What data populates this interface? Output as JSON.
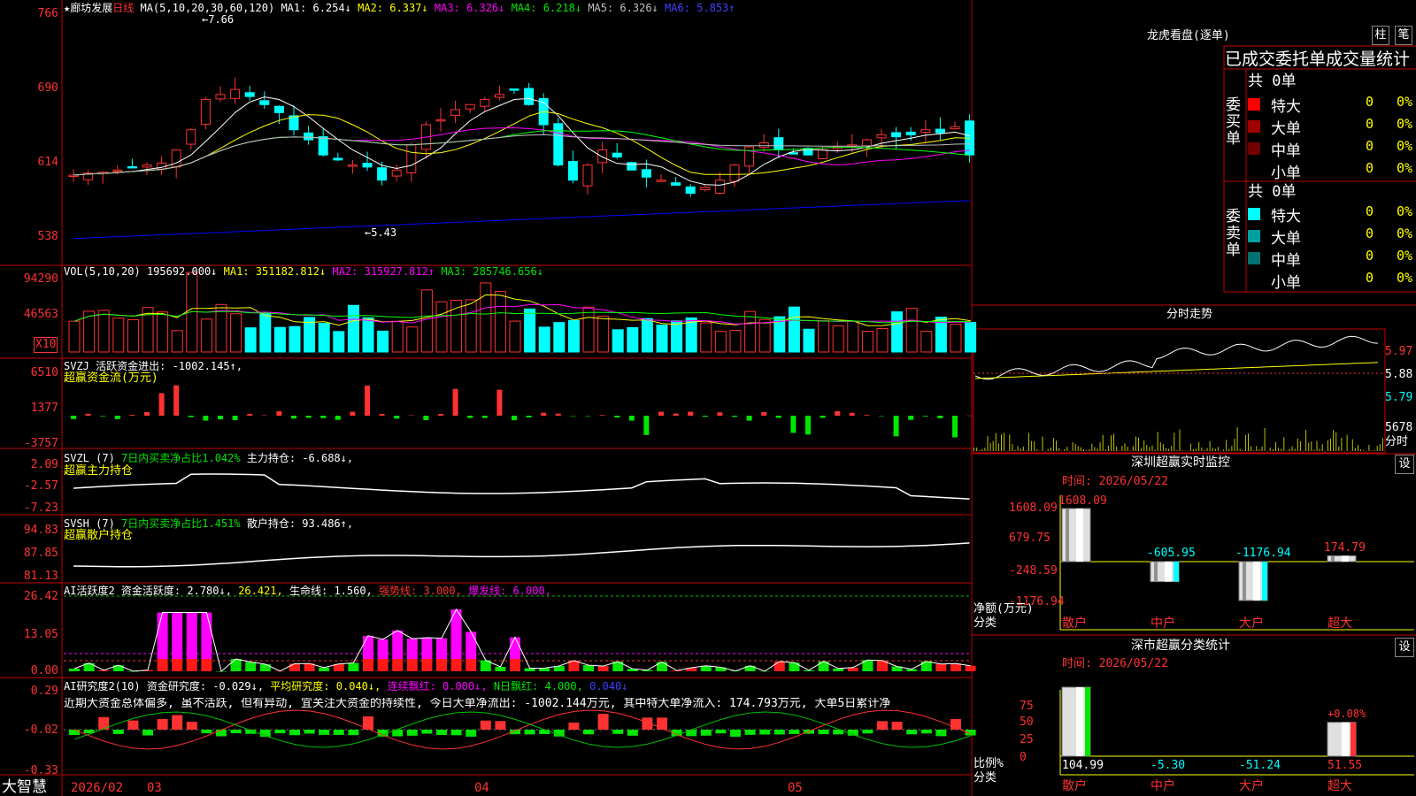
{
  "stock": {
    "name": "★廊坊发展",
    "period": "日线"
  },
  "ma_header": {
    "label": "MA(5,10,20,30,60,120)",
    "ma1": "MA1: 6.254↓",
    "ma2": "MA2: 6.337↓",
    "ma3": "MA3: 6.326↓",
    "ma4": "MA4: 6.218↓",
    "ma5": "MA5: 6.326↓",
    "ma6": "MA6: 5.853↑"
  },
  "price_axis": [
    "766",
    "690",
    "614",
    "538"
  ],
  "price_marks": {
    "high": "7.66",
    "low": "5.43"
  },
  "vol_header": {
    "label": "VOL(5,10,20)",
    "value": "195692.000↓",
    "ma1": "MA1: 351182.812↓",
    "ma2": "MA2: 315927.812↑",
    "ma3": "MA3: 285746.656↓"
  },
  "vol_axis": [
    "94290",
    "46563"
  ],
  "vol_unit": "X10",
  "svzj": {
    "line1": "SVZJ  活跃资金进出: -1002.145↑,",
    "line2": "超赢资金流(万元)",
    "axis": [
      "6510",
      "1377",
      "-3757"
    ]
  },
  "svzl": {
    "label": "SVZL (7)",
    "pct": "7日内买卖净占比1.042%",
    "hold": "主力持仓: -6.688↓,",
    "line2": "超赢主力持仓",
    "axis": [
      "2.09",
      "-2.57",
      "-7.23"
    ]
  },
  "svsh": {
    "label": "SVSH (7)",
    "pct": "7日内买卖净占比1.451%",
    "hold": "散户持仓: 93.486↑,",
    "line2": "超赢散户持仓",
    "axis": [
      "94.83",
      "87.85",
      "81.13"
    ]
  },
  "ai_act": {
    "label": "AI活跃度2",
    "a": "资金活跃度: 2.780↓,",
    "b": "26.421,",
    "c": "生命线: 1.560,",
    "d": "强势线: 3.000,",
    "e": "爆发线: 6.000,",
    "axis": [
      "26.42",
      "13.05",
      "0.00"
    ]
  },
  "ai_res": {
    "label": "AI研究度2(10)",
    "a": "资金研究度: -0.029↓,",
    "b": "平均研究度: 0.040↓,",
    "c": "连续飘红: 0.000↓,",
    "d": "N日飘红: 4.000,",
    "e": "0.040↓",
    "comment": "近期大资金总体偏多, 虽不活跃, 但有异动, 宜关注大资金的持续性, 今日大单净流出: -1002.144万元, 其中特大单净流入: 174.793万元, 大单5日累计净",
    "axis": [
      "0.29",
      "-0.02",
      "-0.33"
    ]
  },
  "date_axis": {
    "brand": "大智慧",
    "d1": "2026/02",
    "d2": "03",
    "d3": "04",
    "d4": "05"
  },
  "lhb": {
    "title": "龙虎看盘(逐单)",
    "btn1": "柱",
    "btn2": "笔",
    "subtitle": "已成交委托单成交量统计",
    "buy_label": "委买单",
    "sell_label": "委卖单",
    "buy_total": "共 0单",
    "sell_total": "共 0单",
    "buy": [
      {
        "name": "特大",
        "n": "0",
        "p": "0%",
        "color": "#ff0000"
      },
      {
        "name": "大单",
        "n": "0",
        "p": "0%",
        "color": "#a00000"
      },
      {
        "name": "中单",
        "n": "0",
        "p": "0%",
        "color": "#700000"
      },
      {
        "name": "小单",
        "n": "0",
        "p": "0%",
        "color": ""
      }
    ],
    "sell": [
      {
        "name": "特大",
        "n": "0",
        "p": "0%",
        "color": "#00ffff"
      },
      {
        "name": "大单",
        "n": "0",
        "p": "0%",
        "color": "#00a0a0"
      },
      {
        "name": "中单",
        "n": "0",
        "p": "0%",
        "color": "#007070"
      },
      {
        "name": "小单",
        "n": "0",
        "p": "0%",
        "color": ""
      }
    ]
  },
  "fenshi": {
    "title": "分时走势",
    "axis": [
      "5.97",
      "5.88",
      "5.79"
    ],
    "vol": "5678",
    "vol_label": "分时"
  },
  "sz_monitor": {
    "title": "深圳超赢实时监控",
    "btn": "设",
    "time": "时间: 2026/05/22",
    "axis": [
      "1608.09",
      "679.75",
      "-248.59",
      "-1176.94"
    ],
    "ylabel": "净额(万元)",
    "xlabel": "分类",
    "values": [
      {
        "cat": "散户",
        "v": 1608.09,
        "t": "1608.09"
      },
      {
        "cat": "中户",
        "v": -605.95,
        "t": "-605.95"
      },
      {
        "cat": "大户",
        "v": -1176.94,
        "t": "-1176.94"
      },
      {
        "cat": "超大",
        "v": 174.79,
        "t": "174.79"
      }
    ]
  },
  "sz_class": {
    "title": "深市超赢分类统计",
    "btn": "设",
    "time": "时间: 2026/05/22",
    "axis": [
      "75",
      "50",
      "25",
      "0"
    ],
    "ylabel": "比例%",
    "xlabel": "分类",
    "note": "+0.08%",
    "values": [
      {
        "cat": "散户",
        "v": 104.99,
        "t": "104.99"
      },
      {
        "cat": "中户",
        "v": -5.3,
        "t": "-5.30"
      },
      {
        "cat": "大户",
        "v": -51.24,
        "t": "-51.24"
      },
      {
        "cat": "超大",
        "v": 51.55,
        "t": "51.55"
      }
    ]
  },
  "colors": {
    "up": "#ff3232",
    "down": "#00ffff",
    "grid": "#c00000",
    "ma1": "#ffffff",
    "ma2": "#ffff00",
    "ma3": "#ff00ff",
    "ma4": "#00ff00",
    "ma5": "#c0c0c0",
    "ma6": "#0000ff"
  }
}
